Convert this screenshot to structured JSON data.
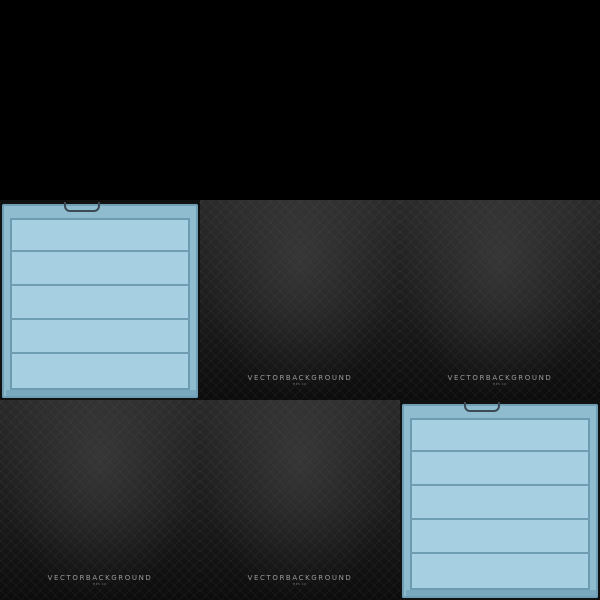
{
  "grid": {
    "tiles": [
      {
        "kind": "shutter"
      },
      {
        "kind": "dark",
        "watermark": "VECTORBACKGROUND",
        "watermark_sub": "EPS 10"
      },
      {
        "kind": "dark",
        "watermark": "VECTORBACKGROUND",
        "watermark_sub": "EPS 10"
      },
      {
        "kind": "dark",
        "watermark": "VECTORBACKGROUND",
        "watermark_sub": "EPS 10"
      },
      {
        "kind": "dark",
        "watermark": "VECTORBACKGROUND",
        "watermark_sub": "EPS 10"
      },
      {
        "kind": "shutter"
      }
    ]
  },
  "colors": {
    "background": "#000000",
    "shutter_blue": "#a6d0e2",
    "dark_tile": "#1c1c1c"
  }
}
